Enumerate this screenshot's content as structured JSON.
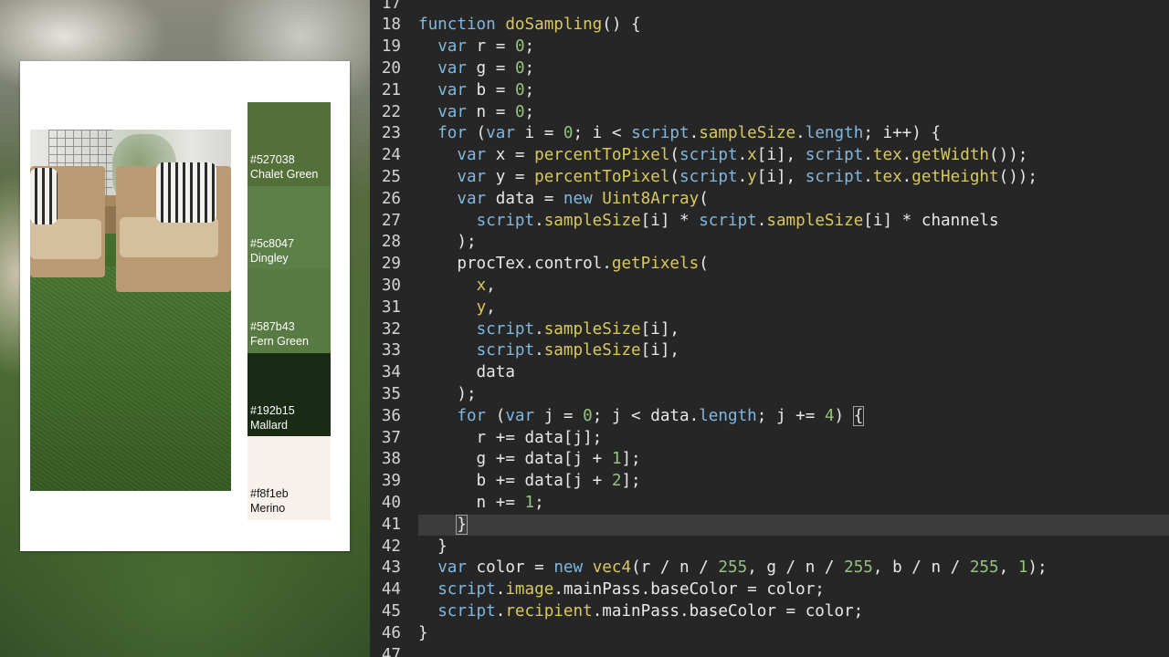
{
  "palette": {
    "swatches": [
      {
        "hex": "#527038",
        "name": "Chalet Green",
        "color": "#527038",
        "text_color": "#ffffff"
      },
      {
        "hex": "#5c8047",
        "name": "Dingley",
        "color": "#5c8047",
        "text_color": "#ffffff"
      },
      {
        "hex": "#587b43",
        "name": "Fern Green",
        "color": "#587b43",
        "text_color": "#ffffff"
      },
      {
        "hex": "#192b15",
        "name": "Mallard",
        "color": "#192b15",
        "text_color": "#ffffff"
      },
      {
        "hex": "#f8f1eb",
        "name": "Merino",
        "color": "#f8f1eb",
        "text_color": "#111111"
      }
    ]
  },
  "editor": {
    "colors": {
      "background": "#262626",
      "keyword": "#7fb8e0",
      "function": "#d8c95f",
      "number": "#93c47d",
      "highlight": "#3c3c3c"
    },
    "lines": [
      {
        "n": "17",
        "tokens": []
      },
      {
        "n": "18",
        "tokens": [
          [
            "kw",
            "function"
          ],
          [
            "pl",
            " "
          ],
          [
            "fn",
            "doSampling"
          ],
          [
            "pl",
            "() {"
          ]
        ]
      },
      {
        "n": "19",
        "tokens": [
          [
            "pl",
            "  "
          ],
          [
            "kw",
            "var"
          ],
          [
            "pl",
            " r = "
          ],
          [
            "num",
            "0"
          ],
          [
            "pl",
            ";"
          ]
        ]
      },
      {
        "n": "20",
        "tokens": [
          [
            "pl",
            "  "
          ],
          [
            "kw",
            "var"
          ],
          [
            "pl",
            " g = "
          ],
          [
            "num",
            "0"
          ],
          [
            "pl",
            ";"
          ]
        ]
      },
      {
        "n": "21",
        "tokens": [
          [
            "pl",
            "  "
          ],
          [
            "kw",
            "var"
          ],
          [
            "pl",
            " b = "
          ],
          [
            "num",
            "0"
          ],
          [
            "pl",
            ";"
          ]
        ]
      },
      {
        "n": "22",
        "tokens": [
          [
            "pl",
            "  "
          ],
          [
            "kw",
            "var"
          ],
          [
            "pl",
            " n = "
          ],
          [
            "num",
            "0"
          ],
          [
            "pl",
            ";"
          ]
        ]
      },
      {
        "n": "23",
        "tokens": [
          [
            "pl",
            "  "
          ],
          [
            "kw",
            "for"
          ],
          [
            "pl",
            " ("
          ],
          [
            "kw",
            "var"
          ],
          [
            "pl",
            " i = "
          ],
          [
            "num",
            "0"
          ],
          [
            "pl",
            "; i < "
          ],
          [
            "kw",
            "script"
          ],
          [
            "pl",
            "."
          ],
          [
            "pr",
            "sampleSize"
          ],
          [
            "pl",
            "."
          ],
          [
            "kw",
            "length"
          ],
          [
            "pl",
            "; i++) {"
          ]
        ]
      },
      {
        "n": "24",
        "tokens": [
          [
            "pl",
            "    "
          ],
          [
            "kw",
            "var"
          ],
          [
            "pl",
            " x = "
          ],
          [
            "fn",
            "percentToPixel"
          ],
          [
            "pl",
            "("
          ],
          [
            "kw",
            "script"
          ],
          [
            "pl",
            "."
          ],
          [
            "pr",
            "x"
          ],
          [
            "pl",
            "[i], "
          ],
          [
            "kw",
            "script"
          ],
          [
            "pl",
            "."
          ],
          [
            "pr",
            "tex"
          ],
          [
            "pl",
            "."
          ],
          [
            "fn",
            "getWidth"
          ],
          [
            "pl",
            "());"
          ]
        ]
      },
      {
        "n": "25",
        "tokens": [
          [
            "pl",
            "    "
          ],
          [
            "kw",
            "var"
          ],
          [
            "pl",
            " y = "
          ],
          [
            "fn",
            "percentToPixel"
          ],
          [
            "pl",
            "("
          ],
          [
            "kw",
            "script"
          ],
          [
            "pl",
            "."
          ],
          [
            "pr",
            "y"
          ],
          [
            "pl",
            "[i], "
          ],
          [
            "kw",
            "script"
          ],
          [
            "pl",
            "."
          ],
          [
            "pr",
            "tex"
          ],
          [
            "pl",
            "."
          ],
          [
            "fn",
            "getHeight"
          ],
          [
            "pl",
            "());"
          ]
        ]
      },
      {
        "n": "26",
        "tokens": [
          [
            "pl",
            "    "
          ],
          [
            "kw",
            "var"
          ],
          [
            "pl",
            " data = "
          ],
          [
            "kw",
            "new"
          ],
          [
            "pl",
            " "
          ],
          [
            "fn",
            "Uint8Array"
          ],
          [
            "pl",
            "("
          ]
        ]
      },
      {
        "n": "27",
        "tokens": [
          [
            "pl",
            "      "
          ],
          [
            "kw",
            "script"
          ],
          [
            "pl",
            "."
          ],
          [
            "pr",
            "sampleSize"
          ],
          [
            "pl",
            "[i] * "
          ],
          [
            "kw",
            "script"
          ],
          [
            "pl",
            "."
          ],
          [
            "pr",
            "sampleSize"
          ],
          [
            "pl",
            "[i] * channels"
          ]
        ]
      },
      {
        "n": "28",
        "tokens": [
          [
            "pl",
            "    );"
          ]
        ]
      },
      {
        "n": "29",
        "tokens": [
          [
            "pl",
            "    procTex.control."
          ],
          [
            "fn",
            "getPixels"
          ],
          [
            "pl",
            "("
          ]
        ]
      },
      {
        "n": "30",
        "tokens": [
          [
            "pl",
            "      "
          ],
          [
            "pr",
            "x"
          ],
          [
            "pl",
            ","
          ]
        ]
      },
      {
        "n": "31",
        "tokens": [
          [
            "pl",
            "      "
          ],
          [
            "pr",
            "y"
          ],
          [
            "pl",
            ","
          ]
        ]
      },
      {
        "n": "32",
        "tokens": [
          [
            "pl",
            "      "
          ],
          [
            "kw",
            "script"
          ],
          [
            "pl",
            "."
          ],
          [
            "pr",
            "sampleSize"
          ],
          [
            "pl",
            "[i],"
          ]
        ]
      },
      {
        "n": "33",
        "tokens": [
          [
            "pl",
            "      "
          ],
          [
            "kw",
            "script"
          ],
          [
            "pl",
            "."
          ],
          [
            "pr",
            "sampleSize"
          ],
          [
            "pl",
            "[i],"
          ]
        ]
      },
      {
        "n": "34",
        "tokens": [
          [
            "pl",
            "      data"
          ]
        ]
      },
      {
        "n": "35",
        "tokens": [
          [
            "pl",
            "    );"
          ]
        ]
      },
      {
        "n": "36",
        "tokens": [
          [
            "pl",
            "    "
          ],
          [
            "kw",
            "for"
          ],
          [
            "pl",
            " ("
          ],
          [
            "kw",
            "var"
          ],
          [
            "pl",
            " j = "
          ],
          [
            "num",
            "0"
          ],
          [
            "pl",
            "; j < data."
          ],
          [
            "kw",
            "length"
          ],
          [
            "pl",
            "; j += "
          ],
          [
            "num",
            "4"
          ],
          [
            "pl",
            ") "
          ],
          [
            "brace",
            "{"
          ]
        ]
      },
      {
        "n": "37",
        "tokens": [
          [
            "pl",
            "      r += data[j];"
          ]
        ]
      },
      {
        "n": "38",
        "tokens": [
          [
            "pl",
            "      g += data[j + "
          ],
          [
            "num",
            "1"
          ],
          [
            "pl",
            "];"
          ]
        ]
      },
      {
        "n": "39",
        "tokens": [
          [
            "pl",
            "      b += data[j + "
          ],
          [
            "num",
            "2"
          ],
          [
            "pl",
            "];"
          ]
        ]
      },
      {
        "n": "40",
        "tokens": [
          [
            "pl",
            "      n += "
          ],
          [
            "num",
            "1"
          ],
          [
            "pl",
            ";"
          ]
        ]
      },
      {
        "n": "41",
        "tokens": [
          [
            "pl",
            "    "
          ],
          [
            "brace",
            "}"
          ],
          [
            "cursor",
            ""
          ]
        ],
        "current": true
      },
      {
        "n": "42",
        "tokens": [
          [
            "pl",
            "  }"
          ]
        ]
      },
      {
        "n": "43",
        "tokens": [
          [
            "pl",
            "  "
          ],
          [
            "kw",
            "var"
          ],
          [
            "pl",
            " color = "
          ],
          [
            "kw",
            "new"
          ],
          [
            "pl",
            " "
          ],
          [
            "fn",
            "vec4"
          ],
          [
            "pl",
            "(r / n / "
          ],
          [
            "num",
            "255"
          ],
          [
            "pl",
            ", g / n / "
          ],
          [
            "num",
            "255"
          ],
          [
            "pl",
            ", b / n / "
          ],
          [
            "num",
            "255"
          ],
          [
            "pl",
            ", "
          ],
          [
            "num",
            "1"
          ],
          [
            "pl",
            ");"
          ]
        ]
      },
      {
        "n": "44",
        "tokens": [
          [
            "pl",
            "  "
          ],
          [
            "kw",
            "script"
          ],
          [
            "pl",
            "."
          ],
          [
            "pr",
            "image"
          ],
          [
            "pl",
            ".mainPass.baseColor = color;"
          ]
        ]
      },
      {
        "n": "45",
        "tokens": [
          [
            "pl",
            "  "
          ],
          [
            "kw",
            "script"
          ],
          [
            "pl",
            "."
          ],
          [
            "pr",
            "recipient"
          ],
          [
            "pl",
            ".mainPass.baseColor = color;"
          ]
        ]
      },
      {
        "n": "46",
        "tokens": [
          [
            "pl",
            "}"
          ]
        ]
      },
      {
        "n": "47",
        "tokens": []
      }
    ]
  }
}
